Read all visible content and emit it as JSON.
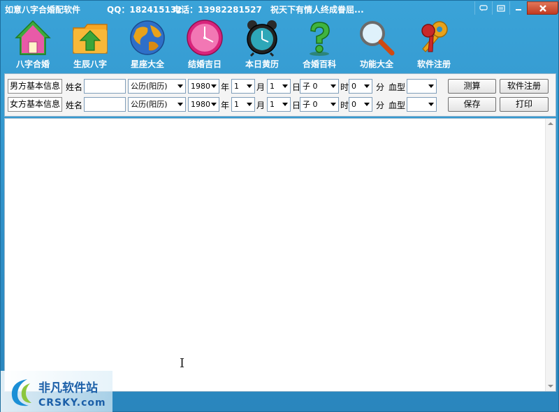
{
  "titlebar": {
    "app_title": "如意八字合婚配软件",
    "qq": "QQ：182415132",
    "phone": "电话：13982281527",
    "slogan": "祝天下有情人终成眷屈..."
  },
  "toolbar": {
    "items": [
      {
        "label": "八字合婚",
        "icon": "house-icon"
      },
      {
        "label": "生辰八字",
        "icon": "upload-folder-icon"
      },
      {
        "label": "星座大全",
        "icon": "globe-icon"
      },
      {
        "label": "结婚吉日",
        "icon": "clock-icon"
      },
      {
        "label": "本日黄历",
        "icon": "alarm-clock-icon"
      },
      {
        "label": "合婚百科",
        "icon": "question-mark-icon"
      },
      {
        "label": "功能大全",
        "icon": "magnifier-icon"
      },
      {
        "label": "软件注册",
        "icon": "keys-icon"
      }
    ]
  },
  "form": {
    "rows": [
      {
        "section_label": "男方基本信息",
        "name_label": "姓名",
        "name_value": "",
        "calendar": "公历(阳历)",
        "year": "1980",
        "year_label": "年",
        "month": "1",
        "month_label": "月",
        "day": "1",
        "day_label": "日",
        "hour": "子 0",
        "hour_label": "时",
        "minute": "0",
        "minute_label": "分",
        "blood_label": "血型",
        "blood": "",
        "button_a": "测算",
        "button_b": "软件注册"
      },
      {
        "section_label": "女方基本信息",
        "name_label": "姓名",
        "name_value": "",
        "calendar": "公历(阳历)",
        "year": "1980",
        "year_label": "年",
        "month": "1",
        "month_label": "月",
        "day": "1",
        "day_label": "日",
        "hour": "子 0",
        "hour_label": "时",
        "minute": "0",
        "minute_label": "分",
        "blood_label": "血型",
        "blood": "",
        "button_a": "保存",
        "button_b": "打印"
      }
    ]
  },
  "watermark": {
    "cn": "非凡软件站",
    "en": "CRSKY.com"
  },
  "colors": {
    "chrome": "#2e8fc4",
    "panel": "#f4f4f4",
    "close": "#c03b21"
  }
}
